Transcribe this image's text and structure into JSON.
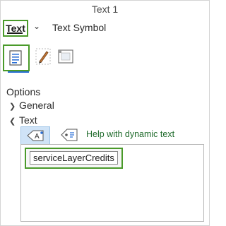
{
  "window": {
    "title": "Text 1"
  },
  "tabs": [
    {
      "label": "Text",
      "selected": true
    },
    {
      "label": "Text Symbol",
      "selected": false
    }
  ],
  "icon_tabs": [
    {
      "icon": "text-properties-icon",
      "selected": true
    },
    {
      "icon": "pencil-icon",
      "selected": false
    },
    {
      "icon": "frame-icon",
      "selected": false
    }
  ],
  "options": {
    "heading": "Options",
    "tree": [
      {
        "label": "General",
        "expanded": false
      },
      {
        "label": "Text",
        "expanded": true
      }
    ]
  },
  "text_toolbar": {
    "insert_icon": "text-insert-icon",
    "dynamic_icon": "dynamic-text-tag-icon",
    "help_label": "Help with dynamic text"
  },
  "expression": {
    "token": "serviceLayerCredits"
  },
  "colors": {
    "highlight": "#4a9a2a",
    "accent": "#2a6fd6",
    "help_text": "#1f6b2b"
  }
}
